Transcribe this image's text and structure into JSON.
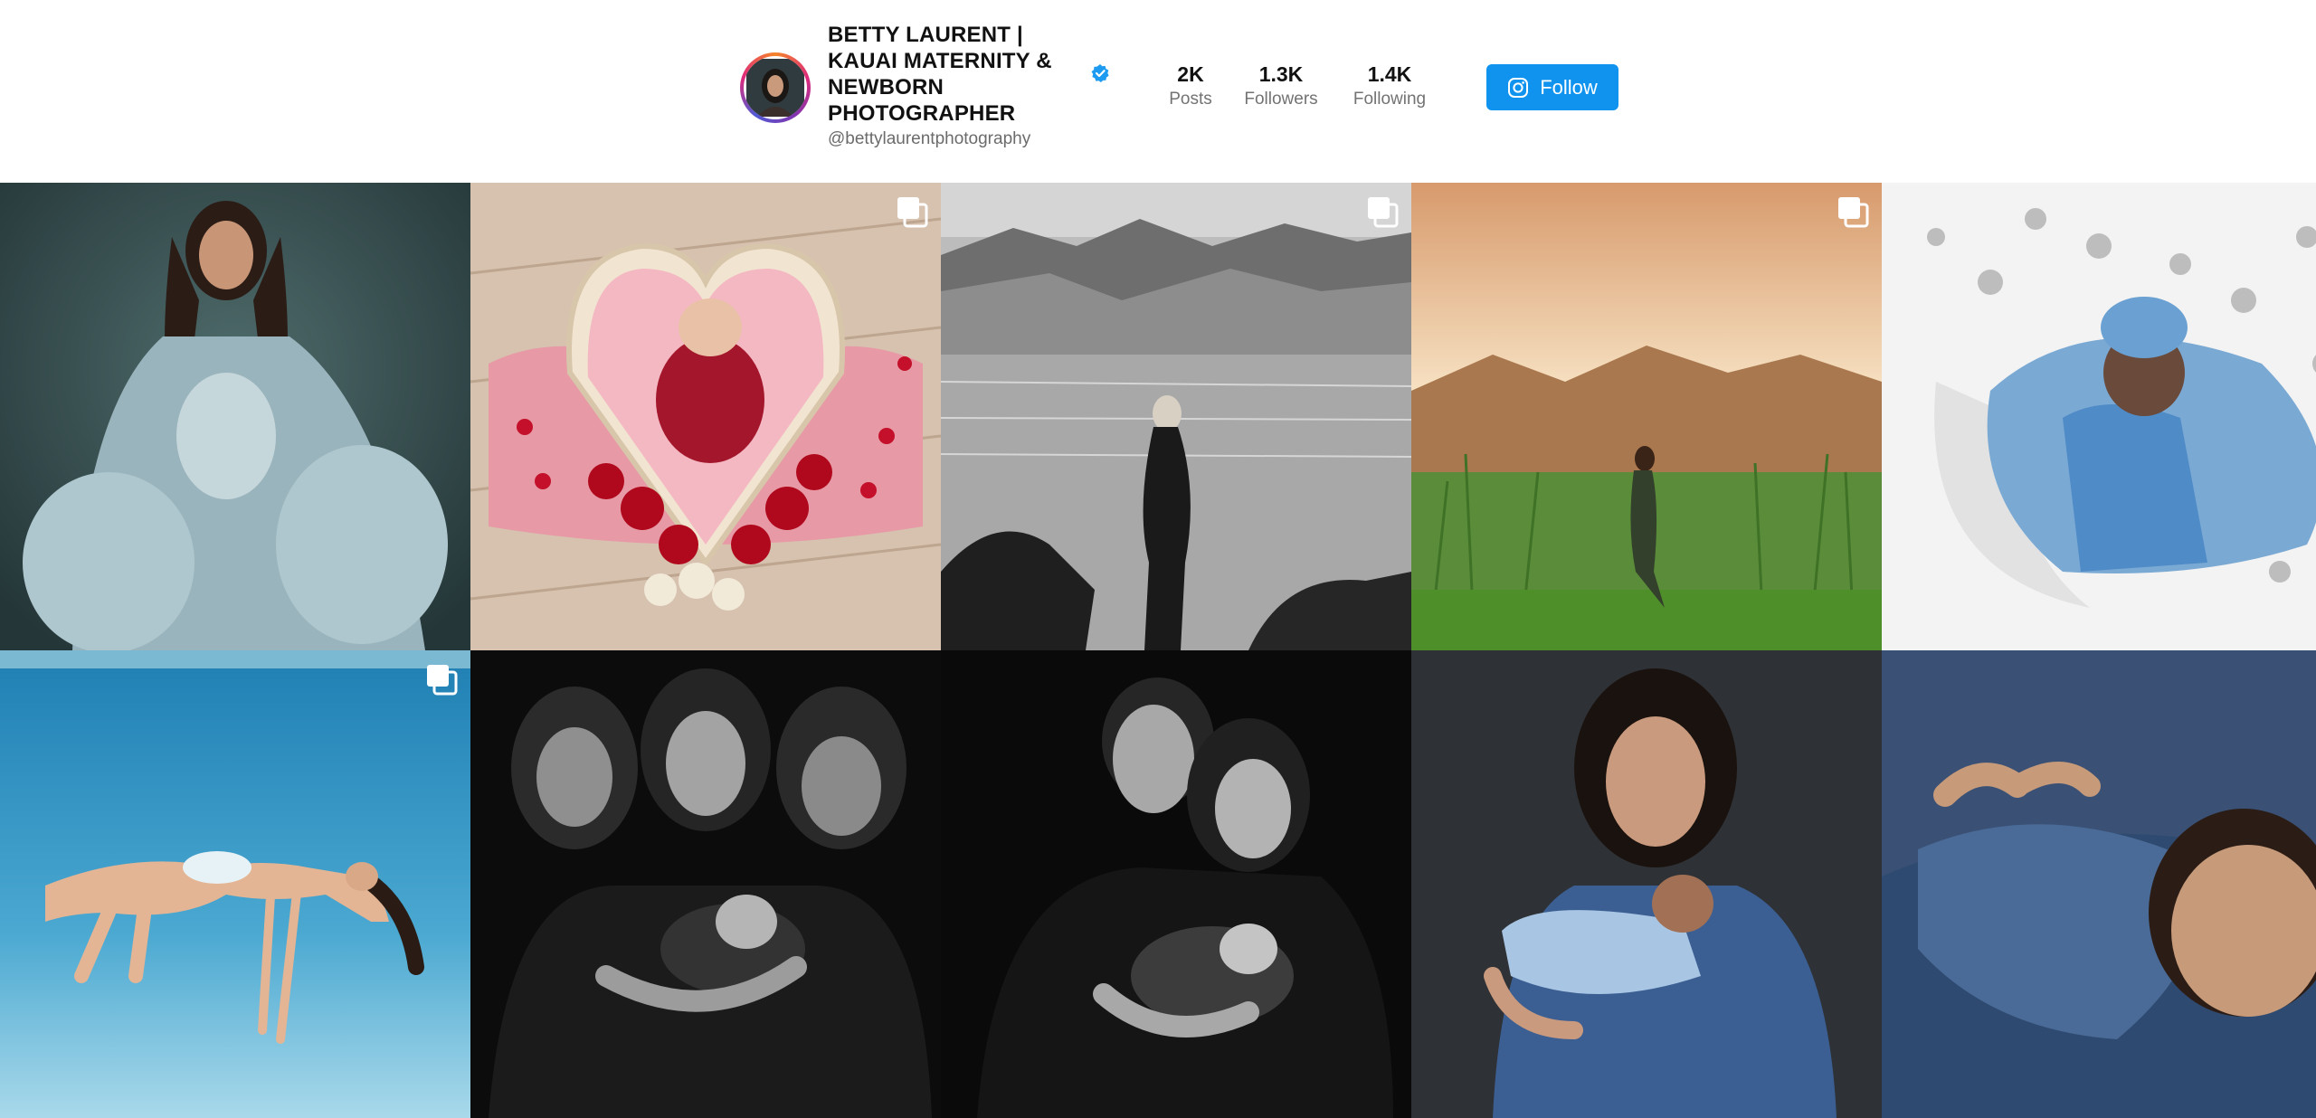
{
  "profile": {
    "name": "BETTY LAURENT | KAUAI MATERNITY & NEWBORN PHOTOGRAPHER",
    "handle": "@bettylaurentphotography",
    "verified": true,
    "avatar_icon": "profile-photo"
  },
  "stats": [
    {
      "value": "2K",
      "label": "Posts"
    },
    {
      "value": "1.3K",
      "label": "Followers"
    },
    {
      "value": "1.4K",
      "label": "Following"
    }
  ],
  "follow_button": {
    "label": "Follow",
    "icon": "instagram-icon"
  },
  "colors": {
    "accent": "#0f93ee",
    "verified": "#1d9bf0",
    "text": "#111111",
    "muted": "#737373"
  },
  "posts": [
    {
      "subject": "maternity-ruffle-dress",
      "multi": false
    },
    {
      "subject": "newborn-heart-bowl",
      "multi": true
    },
    {
      "subject": "bw-beach-maternity",
      "multi": true
    },
    {
      "subject": "sunset-field-maternity",
      "multi": true
    },
    {
      "subject": "newborn-moon-stars",
      "multi": false
    },
    {
      "subject": "underwater-maternity",
      "multi": true
    },
    {
      "subject": "bw-three-generations",
      "multi": false
    },
    {
      "subject": "bw-family-newborn",
      "multi": false
    },
    {
      "subject": "mother-and-newborn-blue",
      "multi": false
    },
    {
      "subject": "newborn-blue-wrap",
      "multi": true
    }
  ]
}
